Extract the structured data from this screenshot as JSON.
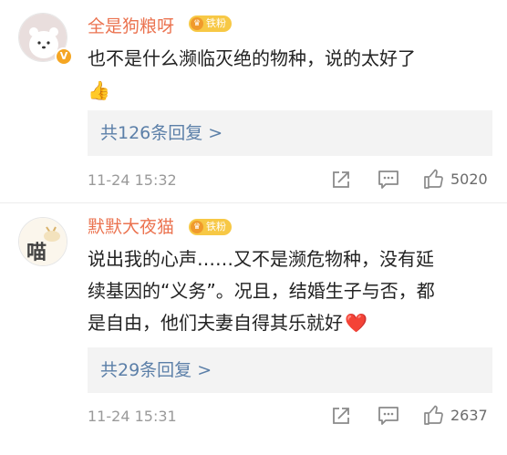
{
  "comments": [
    {
      "username": "全是狗粮呀",
      "fan_badge": "铁粉",
      "text": "也不是什么濒临灭绝的物种，说的太好了",
      "emoji": "👍",
      "replies": "共126条回复 >",
      "time": "11-24 15:32",
      "likes": "5020",
      "avatar_icon": "polar-bear-avatar",
      "verified": true
    },
    {
      "username": "默默大夜猫",
      "fan_badge": "铁粉",
      "text_lines": [
        "说出我的心声……又不是濒危物种，没有延",
        "续基因的“义务”。况且，结婚生子与否，都",
        "是自由，他们夫妻自得其乐就好"
      ],
      "emoji": "❤️",
      "replies": "共29条回复 >",
      "time": "11-24 15:31",
      "likes": "2637",
      "avatar_icon": "cat-meow-avatar"
    }
  ],
  "colors": {
    "username": "#eb7350",
    "replies_link": "#5b7fa8",
    "meta": "#9a9a9a",
    "badge": "#f7c845"
  }
}
